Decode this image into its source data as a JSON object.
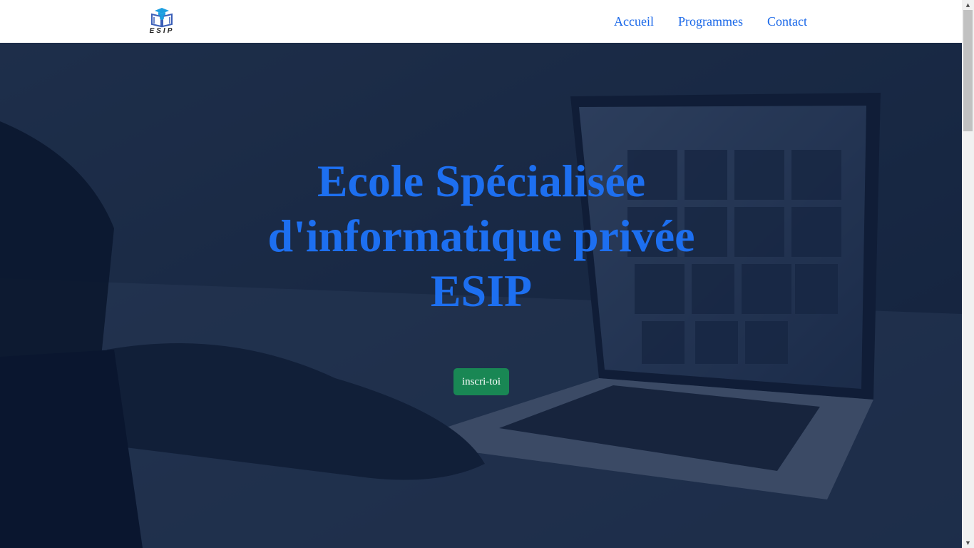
{
  "logo": {
    "text": "ESIP",
    "icon": "graduation-book-icon"
  },
  "nav": {
    "items": [
      {
        "label": "Accueil"
      },
      {
        "label": "Programmes"
      },
      {
        "label": "Contact"
      }
    ]
  },
  "hero": {
    "title_lines": [
      "Ecole Spécialisée",
      "d'informatique privée",
      "ESIP"
    ],
    "cta_label": "inscri-toi",
    "background": "laptop-keyboard-photo"
  },
  "colors": {
    "accent": "#1d6ff0",
    "nav_link": "#1766e8",
    "cta": "#198754",
    "overlay": "#081630"
  },
  "scrollbar": {
    "up_icon": "scroll-up-arrow-icon",
    "down_icon": "scroll-down-arrow-icon"
  }
}
